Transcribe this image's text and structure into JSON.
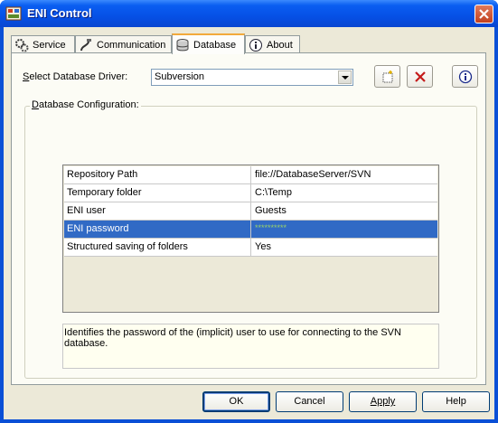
{
  "window": {
    "title": "ENI Control",
    "icon": "eni-control-icon"
  },
  "tabs": [
    {
      "label": "Service",
      "icon": "gears-icon",
      "active": false
    },
    {
      "label": "Communication",
      "icon": "cable-icon",
      "active": false
    },
    {
      "label": "Database",
      "icon": "database-icon",
      "active": true
    },
    {
      "label": "About",
      "icon": "info-icon",
      "active": false
    }
  ],
  "driver": {
    "label": "Select Database Driver:",
    "mnemonic": "S",
    "label_rest": "elect Database Driver:",
    "selected": "Subversion"
  },
  "toolbar": {
    "new_icon": "new-icon",
    "delete_icon": "delete-icon",
    "info_icon": "info-icon"
  },
  "config": {
    "title": "Database Configuration:",
    "mnemonic": "D",
    "title_rest": "atabase Configuration:",
    "rows": [
      {
        "name": "Repository Path",
        "value": "file://DatabaseServer/SVN"
      },
      {
        "name": "Temporary folder",
        "value": "C:\\Temp"
      },
      {
        "name": "ENI user",
        "value": "Guests"
      },
      {
        "name": "ENI password",
        "value": "**********"
      },
      {
        "name": "Structured saving of folders",
        "value": "Yes"
      }
    ],
    "selected_row": 3,
    "description": "Identifies the password of the (implicit) user to use for connecting to the SVN database."
  },
  "buttons": {
    "ok": "OK",
    "cancel": "Cancel",
    "apply": "Apply",
    "help": "Help"
  },
  "colors": {
    "titlebar": "#0650e6",
    "selection": "#316ac5",
    "tab_highlight": "#f2a93b",
    "dialog_bg": "#ece9d8"
  }
}
